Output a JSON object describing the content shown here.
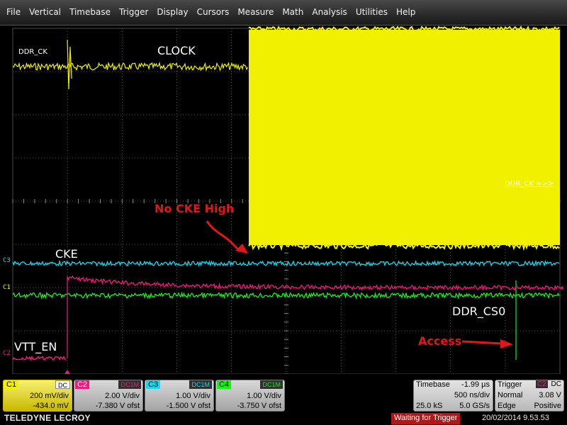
{
  "menu": [
    "File",
    "Vertical",
    "Timebase",
    "Trigger",
    "Display",
    "Cursors",
    "Measure",
    "Math",
    "Analysis",
    "Utilities",
    "Help"
  ],
  "colors": {
    "c1": "#f0f000",
    "c2": "#f0187c",
    "c3": "#18d8f0",
    "c4": "#18f018",
    "grid": "#4a4a4a",
    "annotation": "#e0161c"
  },
  "screen": {
    "labels": {
      "ddr_ck": "DDR_CK",
      "clock": "CLOCK",
      "cke": "CKE",
      "vtt_en": "VTT_EN",
      "ddr_cs0": "DDR_CS0",
      "no_cke_high": "No CKE High",
      "access": "Access",
      "overlay": "DDR_CK =>>"
    },
    "markers": {
      "c3": "C3",
      "c1": "C1",
      "c2": "C2"
    }
  },
  "channels": [
    {
      "id": "C1",
      "coupling": "DC",
      "vdiv": "200 mV/div",
      "offset": "-434.0 mV"
    },
    {
      "id": "C2",
      "coupling": "DC1M",
      "vdiv": "2.00 V/div",
      "offset": "-7.380 V ofst"
    },
    {
      "id": "C3",
      "coupling": "DC1M",
      "vdiv": "1.00 V/div",
      "offset": "-1.500 V ofst"
    },
    {
      "id": "C4",
      "coupling": "DC1M",
      "vdiv": "1.00 V/div",
      "offset": "-3.750 V ofst"
    }
  ],
  "timebase": {
    "label": "Timebase",
    "delay": "-1.99 µs",
    "tdiv": "500 ns/div",
    "samples": "25.0 kS",
    "rate": "5.0 GS/s"
  },
  "trigger": {
    "label": "Trigger",
    "source": "C2",
    "coupling": "DC",
    "mode": "Normal",
    "level": "3.08 V",
    "type": "Edge",
    "slope": "Positive"
  },
  "footer": {
    "brand": "TELEDYNE LECROY",
    "status": "Waiting for Trigger",
    "datetime": "20/02/2014 9.53.53"
  }
}
